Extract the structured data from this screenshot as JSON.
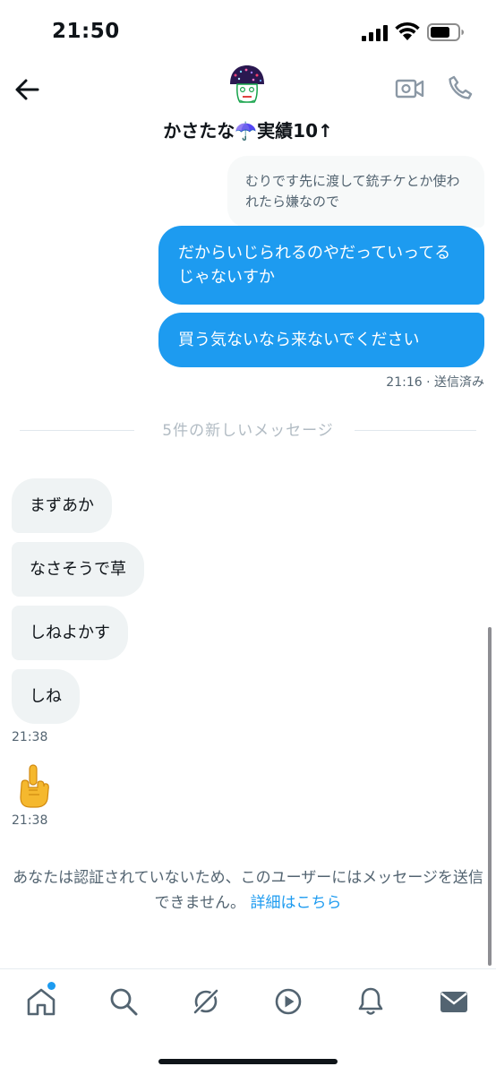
{
  "status_bar": {
    "time": "21:50"
  },
  "header": {
    "contact_name": "かさたな☂️実績10↑"
  },
  "messages": {
    "outgoing": [
      {
        "text": "むりです先に渡して銃チケとか使われたら嫌なので"
      },
      {
        "text": "だからいじられるのやだっていってるじゃないすか"
      },
      {
        "text": "買う気ないなら来ないでください"
      }
    ],
    "outgoing_meta": "21:16 · 送信済み",
    "divider_label": "5件の新しいメッセージ",
    "incoming": [
      {
        "text": "まずあか"
      },
      {
        "text": "なさそうで草"
      },
      {
        "text": "しねよかす"
      },
      {
        "text": "しね"
      }
    ],
    "incoming_time_1": "21:38",
    "incoming_time_2": "21:38"
  },
  "notice": {
    "text": "あなたは認証されていないため、このユーザーにはメッセージを送信できません。",
    "link_label": "詳細はこちら"
  },
  "nav": {
    "items": [
      "home-icon",
      "search-icon",
      "grok-icon",
      "play-icon",
      "bell-icon",
      "mail-icon"
    ],
    "accent_color": "#1d9bf0"
  },
  "colors": {
    "outgoing_bubble": "#1d9bf0",
    "incoming_bubble": "#eff3f4",
    "text_secondary": "#536471"
  }
}
